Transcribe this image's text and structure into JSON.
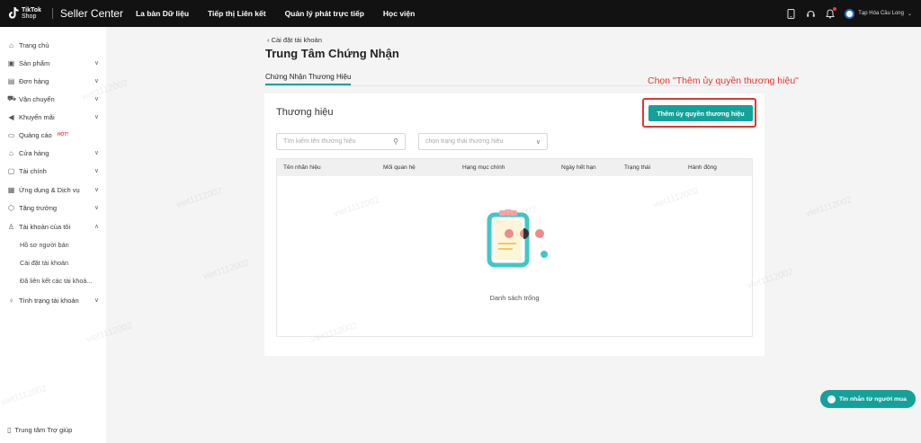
{
  "topbar": {
    "logo_line1": "TikTok",
    "logo_line2": "Shop",
    "title": "Seller Center",
    "nav": [
      "La bàn Dữ liệu",
      "Tiếp thị Liên kết",
      "Quản lý phát trực tiếp",
      "Học viện"
    ],
    "shop_name": "Tạp Hóa Cầu Long",
    "icons": [
      "phone-icon",
      "headset-icon",
      "bell-icon"
    ]
  },
  "sidebar": {
    "items": [
      {
        "label": "Trang chủ",
        "icon": "home-icon"
      },
      {
        "label": "Sản phẩm",
        "icon": "box-icon"
      },
      {
        "label": "Đơn hàng",
        "icon": "clipboard-icon"
      },
      {
        "label": "Vận chuyển",
        "icon": "truck-icon"
      },
      {
        "label": "Khuyến mãi",
        "icon": "megaphone-icon"
      },
      {
        "label": "Quảng cáo",
        "icon": "ads-icon",
        "badge": "HOT!"
      },
      {
        "label": "Cửa hàng",
        "icon": "store-icon"
      },
      {
        "label": "Tài chính",
        "icon": "wallet-icon"
      },
      {
        "label": "Ứng dụng & Dịch vụ",
        "icon": "apps-icon"
      },
      {
        "label": "Tăng trưởng",
        "icon": "growth-icon"
      },
      {
        "label": "Tài khoản của tôi",
        "icon": "user-icon"
      }
    ],
    "sub_items": [
      "Hồ sơ người bán",
      "Cài đặt tài khoản",
      "Đã liên kết các tài khoả..."
    ],
    "status_item": "Tình trạng tài khoản",
    "help": "Trung tâm Trợ giúp"
  },
  "main": {
    "back_label": "Cài đặt tài khoản",
    "title": "Trung Tâm Chứng Nhận",
    "tab": "Chứng Nhận Thương Hiệu",
    "annotation": "Chọn \"Thêm ủy quyền thương hiệu\"",
    "card_title": "Thương hiệu",
    "add_button": "Thêm ủy quyền thương hiệu",
    "search_placeholder": "Tìm kiếm tên thương hiệu",
    "select_placeholder": "chọn trạng thái thương hiệu",
    "columns": [
      "Tên nhãn hiệu",
      "Mối quan hệ",
      "Hạng mục chính",
      "Ngày hết hạn",
      "Trạng thái",
      "Hành động"
    ],
    "empty_text": "Danh sách trống"
  },
  "chat_button": "Tin nhắn từ người mua",
  "watermark": "viet1112002",
  "colors": {
    "accent": "#14a19a",
    "highlight": "#e6352e",
    "topbar": "#121212"
  }
}
